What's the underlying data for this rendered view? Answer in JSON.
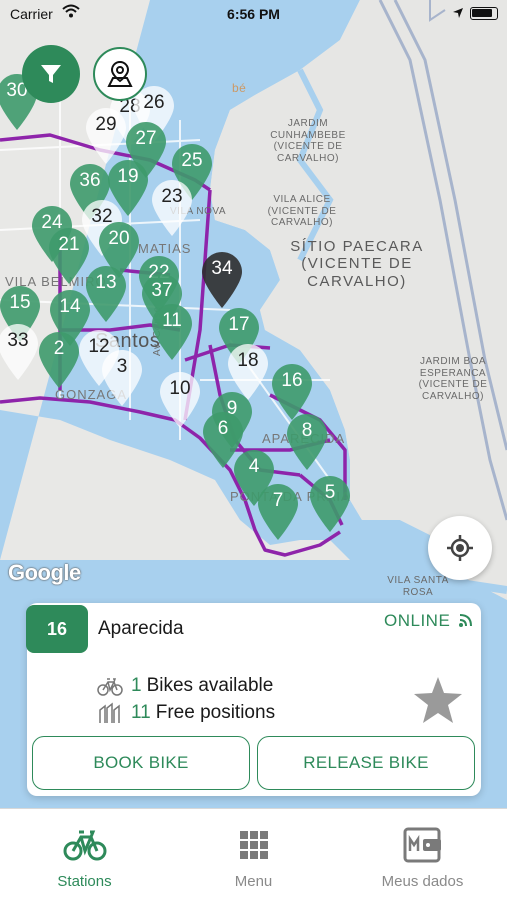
{
  "status_bar": {
    "carrier": "Carrier",
    "time": "6:56 PM"
  },
  "map": {
    "labels": {
      "jardim_cunhambebe": "JARDIM\nCUNHAMBEBE\n(VICENTE DE\nCARVALHO)",
      "vila_alice": "VILA ALICE\n(VICENTE DE\nCARVALHO)",
      "sitio_paecara": "SÍTIO PAECARA\n(VICENTE DE\nCARVALHO)",
      "jardim_boa_esperanca": "JARDIM BOA\nESPERANCA\n(VICENTE DE\nCARVALHO)",
      "vila_santa_rosa": "VILA SANTA\nROSA",
      "vila_belmiro": "VILA BELMIRO",
      "matias": "MATIAS",
      "santos": "Santos",
      "gonzaga": "GONZAGA",
      "aparecida": "APARECIDA",
      "ponta_da_praia": "PONTA DA PRAIA",
      "vila_nova": "VILA NOVA",
      "av_conselheiro": "Av. Conse",
      "be": "bé"
    },
    "google_logo": "Google",
    "stations": [
      {
        "n": "30",
        "style": "green"
      },
      {
        "n": "28",
        "style": "light"
      },
      {
        "n": "26",
        "style": "light"
      },
      {
        "n": "29",
        "style": "light"
      },
      {
        "n": "27",
        "style": "green"
      },
      {
        "n": "25",
        "style": "green"
      },
      {
        "n": "36",
        "style": "green"
      },
      {
        "n": "19",
        "style": "green"
      },
      {
        "n": "23",
        "style": "light"
      },
      {
        "n": "24",
        "style": "green"
      },
      {
        "n": "32",
        "style": "light"
      },
      {
        "n": "20",
        "style": "green"
      },
      {
        "n": "21",
        "style": "green"
      },
      {
        "n": "22",
        "style": "green"
      },
      {
        "n": "34",
        "style": "dark"
      },
      {
        "n": "13",
        "style": "green"
      },
      {
        "n": "37",
        "style": "green"
      },
      {
        "n": "15",
        "style": "green"
      },
      {
        "n": "14",
        "style": "green"
      },
      {
        "n": "11",
        "style": "green"
      },
      {
        "n": "17",
        "style": "green"
      },
      {
        "n": "33",
        "style": "light"
      },
      {
        "n": "2",
        "style": "green"
      },
      {
        "n": "12",
        "style": "light"
      },
      {
        "n": "3",
        "style": "light"
      },
      {
        "n": "18",
        "style": "light"
      },
      {
        "n": "16",
        "style": "green"
      },
      {
        "n": "10",
        "style": "light"
      },
      {
        "n": "9",
        "style": "green"
      },
      {
        "n": "6",
        "style": "green"
      },
      {
        "n": "8",
        "style": "green"
      },
      {
        "n": "4",
        "style": "green"
      },
      {
        "n": "5",
        "style": "green"
      },
      {
        "n": "7",
        "style": "green"
      }
    ]
  },
  "station_card": {
    "id": "16",
    "name": "Aparecida",
    "status": "ONLINE",
    "bikes_available_count": "1",
    "bikes_available_label": "Bikes available",
    "free_positions_count": "11",
    "free_positions_label": "Free positions",
    "book_button": "BOOK BIKE",
    "release_button": "RELEASE BIKE",
    "favorite": false
  },
  "tabs": [
    {
      "label": "Stations",
      "icon": "bike-icon",
      "active": true
    },
    {
      "label": "Menu",
      "icon": "grid-icon",
      "active": false
    },
    {
      "label": "Meus dados",
      "icon": "wallet-card-icon",
      "active": false
    }
  ],
  "colors": {
    "brand": "#2e8a5a",
    "route": "#8e24aa",
    "water": "#a8d0ee",
    "land": "#e8e8e6"
  }
}
